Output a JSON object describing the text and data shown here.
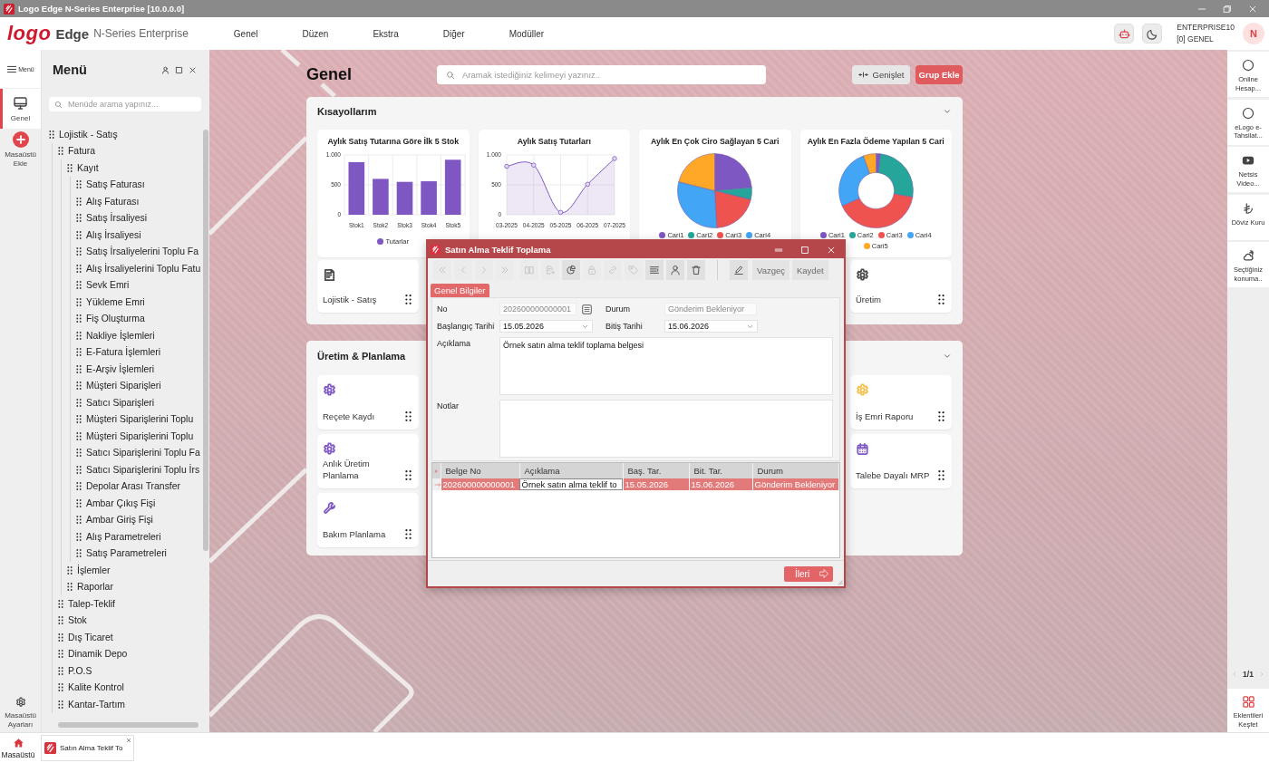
{
  "window": {
    "title": "Logo Edge N-Series Enterprise [10.0.0.0]"
  },
  "header": {
    "brand": "logo",
    "product": "Edge",
    "edition": "N-Series Enterprise",
    "nav": [
      "Genel",
      "Düzen",
      "Ekstra",
      "Diğer",
      "Modüller"
    ],
    "company": "ENTERPRISE10",
    "period": "[0] GENEL",
    "avatar": "N"
  },
  "rail": {
    "menu_label": "Menü",
    "desktops": [
      {
        "label": "Genel",
        "selected": true
      }
    ],
    "add_label": "Masaüstü Ekle",
    "settings_label": "Masaüstü Ayarları"
  },
  "menu_panel": {
    "title": "Menü",
    "search": {
      "placeholder": "Menüde arama yapınız..."
    },
    "tree": [
      {
        "label": "Lojistik - Satış",
        "children": [
          {
            "label": "Fatura",
            "children": [
              {
                "label": "Kayıt",
                "children": [
                  {
                    "label": "Satış Faturası"
                  },
                  {
                    "label": "Alış Faturası"
                  },
                  {
                    "label": "Satış İrsaliyesi"
                  },
                  {
                    "label": "Alış İrsaliyesi"
                  },
                  {
                    "label": "Satış İrsaliyelerini Toplu Fa"
                  },
                  {
                    "label": "Alış İrsaliyelerini Toplu Fatu"
                  },
                  {
                    "label": "Sevk Emri"
                  },
                  {
                    "label": "Yükleme Emri"
                  },
                  {
                    "label": "Fiş Oluşturma"
                  },
                  {
                    "label": "Nakliye İşlemleri"
                  },
                  {
                    "label": "E-Fatura İşlemleri"
                  },
                  {
                    "label": "E-Arşiv İşlemleri"
                  },
                  {
                    "label": "Müşteri Siparişleri"
                  },
                  {
                    "label": "Satıcı Siparişleri"
                  },
                  {
                    "label": "Müşteri Siparişlerini Toplu"
                  },
                  {
                    "label": "Müşteri Siparişlerini Toplu"
                  },
                  {
                    "label": "Satıcı Siparişlerini Toplu Fa"
                  },
                  {
                    "label": "Satıcı Siparişlerini Toplu İrs"
                  },
                  {
                    "label": "Depolar Arası Transfer"
                  },
                  {
                    "label": "Ambar Çıkış Fişi"
                  },
                  {
                    "label": "Ambar Giriş Fişi"
                  },
                  {
                    "label": "Alış Parametreleri"
                  },
                  {
                    "label": "Satış Parametreleri"
                  }
                ]
              },
              {
                "label": "İşlemler"
              },
              {
                "label": "Raporlar"
              }
            ]
          },
          {
            "label": "Talep-Teklif"
          },
          {
            "label": "Stok"
          },
          {
            "label": "Dış Ticaret"
          },
          {
            "label": "Dinamik Depo"
          },
          {
            "label": "P.O.S"
          },
          {
            "label": "Kalite Kontrol"
          },
          {
            "label": "Kantar-Tartım"
          }
        ]
      }
    ]
  },
  "desktop": {
    "title": "Genel",
    "search": {
      "placeholder": "Aramak istediğiniz kelimeyi yazınız.."
    },
    "buttons": [
      {
        "label": "Genişlet",
        "kind": "secondary"
      },
      {
        "label": "Grup Ekle",
        "kind": "primary"
      }
    ],
    "sections": [
      {
        "title": "Kısayollarım",
        "widgets": [
          {
            "chart_data": {
              "type": "bar",
              "title": "Aylık Satış Tutarına Göre İlk 5 Stok",
              "categories": [
                "Stok1",
                "Stok2",
                "Stok3",
                "Stok4",
                "Stok5"
              ],
              "series": [
                {
                  "name": "Tutarlar",
                  "color": "#7e57c2",
                  "values": [
                    880,
                    600,
                    550,
                    560,
                    920
                  ]
                }
              ],
              "ylim": [
                0,
                1000
              ],
              "yticks": [
                {
                  "value": 0,
                  "label": "0"
                },
                {
                  "value": 500,
                  "label": "500"
                },
                {
                  "value": 1000,
                  "label": "1.000"
                }
              ],
              "grid": true
            }
          },
          {
            "chart_data": {
              "type": "area",
              "title": "Aylık Satış Tutarları",
              "categories": [
                "03-2025",
                "04-2025",
                "05-2025",
                "06-2025",
                "07-2025"
              ],
              "series": [
                {
                  "color": "#7e57c2",
                  "values": [
                    810,
                    830,
                    40,
                    510,
                    940
                  ]
                }
              ],
              "ylim": [
                0,
                1000
              ],
              "yticks": [
                {
                  "value": 0,
                  "label": "0"
                },
                {
                  "value": 500,
                  "label": "500"
                },
                {
                  "value": 1000,
                  "label": "1.000"
                }
              ],
              "grid": true
            }
          },
          {
            "kind": "pie",
            "title": "Aylık En Çok Ciro Sağlayan 5 Cari",
            "legend": [
              {
                "label": "Cari1",
                "color": "#7e57c2"
              },
              {
                "label": "Cari2",
                "color": "#26a69a"
              },
              {
                "label": "Cari3",
                "color": "#ef5350"
              },
              {
                "label": "Cari4",
                "color": "#42a5f5"
              }
            ]
          },
          {
            "kind": "donut",
            "title": "Aylık En Fazla Ödeme Yapılan 5 Cari",
            "legend": [
              {
                "label": "Cari1",
                "color": "#7e57c2"
              },
              {
                "label": "Cari2",
                "color": "#26a69a"
              },
              {
                "label": "Cari3",
                "color": "#ef5350"
              },
              {
                "label": "Cari4",
                "color": "#42a5f5"
              },
              {
                "label": "Cari5",
                "color": "#ffa726"
              }
            ]
          }
        ],
        "shortcut_columns": [
          {
            "items": [
              {
                "label": "Lojistik - Satış",
                "kind": "document",
                "color": "#4a4a4a"
              }
            ]
          },
          {
            "items": [
              {
                "label": "Üretim",
                "kind": "gear",
                "color": "#4a4a4a"
              }
            ]
          }
        ]
      },
      {
        "title": "Üretim & Planlama",
        "shortcut_columns": [
          {
            "items": [
              {
                "label": "Reçete Kaydı",
                "kind": "gear",
                "color": "#7e57c2"
              },
              {
                "label": "Anlık Üretim Planlama",
                "kind": "gear",
                "color": "#7e57c2"
              },
              {
                "label": "Bakım Planlama",
                "kind": "wrench",
                "color": "#7e57c2"
              }
            ]
          },
          {
            "items": [
              {
                "label": "İş Emri Raporu",
                "kind": "gear",
                "color": "#f2c14e"
              },
              {
                "label": "Talebe Dayalı MRP",
                "kind": "calendar",
                "color": "#7e57c2"
              }
            ]
          }
        ]
      }
    ]
  },
  "dialog": {
    "title": "Satın Alma Teklif Toplama",
    "toolbar": [
      {
        "kind": "first",
        "disabled": true
      },
      {
        "kind": "previous",
        "disabled": true
      },
      {
        "kind": "next",
        "disabled": true
      },
      {
        "kind": "last",
        "disabled": true
      },
      {
        "kind": "copy",
        "disabled": true
      },
      {
        "kind": "export",
        "disabled": true
      },
      {
        "kind": "history",
        "disabled": false
      },
      {
        "kind": "lock",
        "disabled": true
      },
      {
        "kind": "link",
        "disabled": true
      },
      {
        "kind": "tag",
        "disabled": true
      },
      {
        "kind": "list",
        "disabled": false
      },
      {
        "kind": "user",
        "disabled": false
      },
      {
        "kind": "delete",
        "disabled": false
      },
      {
        "kind": "edit",
        "disabled": false
      }
    ],
    "actions": [
      "Vazgeç",
      "Kaydet"
    ],
    "tabs": [
      {
        "label": "Genel Bilgiler",
        "selected": true
      }
    ],
    "fields": [
      {
        "label": "No",
        "kind": "lookup",
        "value": "202600000000001",
        "readonly": true
      },
      {
        "label": "Durum",
        "kind": "text",
        "value": "Gönderim Bekleniyor",
        "readonly": true
      },
      {
        "label": "Başlangıç Tarihi",
        "kind": "date",
        "value": "15.05.2026",
        "readonly": false
      },
      {
        "label": "Bitiş Tarihi",
        "kind": "date",
        "value": "15.06.2026",
        "readonly": false
      },
      {
        "label": "Açıklama",
        "kind": "memo",
        "value": "Örnek satın alma teklif toplama belgesi",
        "readonly": false
      },
      {
        "label": "Notlar",
        "kind": "memo"
      }
    ],
    "grid": {
      "columns": [
        "Belge No",
        "Açıklama",
        "Baş. Tar.",
        "Bit. Tar.",
        "Durum"
      ],
      "rows": [
        {
          "selected": true,
          "cells": [
            {
              "text": "202600000000001",
              "focused": false
            },
            {
              "text": "Örnek satın alma teklif to",
              "focused": true
            },
            {
              "text": "15.05.2026",
              "focused": false
            },
            {
              "text": "15.06.2026",
              "focused": false
            },
            {
              "text": "Gönderim Bekleniyor",
              "focused": false
            }
          ]
        }
      ]
    },
    "next_label": "İleri"
  },
  "right_sidebar": {
    "widgets": [
      {
        "label": "Online Hesap...",
        "kind": "app"
      },
      {
        "label": "eLogo e-Tahsilat...",
        "kind": "app"
      },
      {
        "label": "Netsis Video...",
        "kind": "video"
      },
      {
        "label": "Döviz Kuru",
        "kind": "currency"
      },
      {
        "label": "Seçtiğiniz konuma..",
        "kind": "weather"
      }
    ],
    "pager": "1/1",
    "explore_label": "Eklentileri Keşfet"
  },
  "taskbar": {
    "home_label": "Masaüstü",
    "tabs": [
      {
        "label": "Satın Alma Teklif To"
      }
    ]
  }
}
